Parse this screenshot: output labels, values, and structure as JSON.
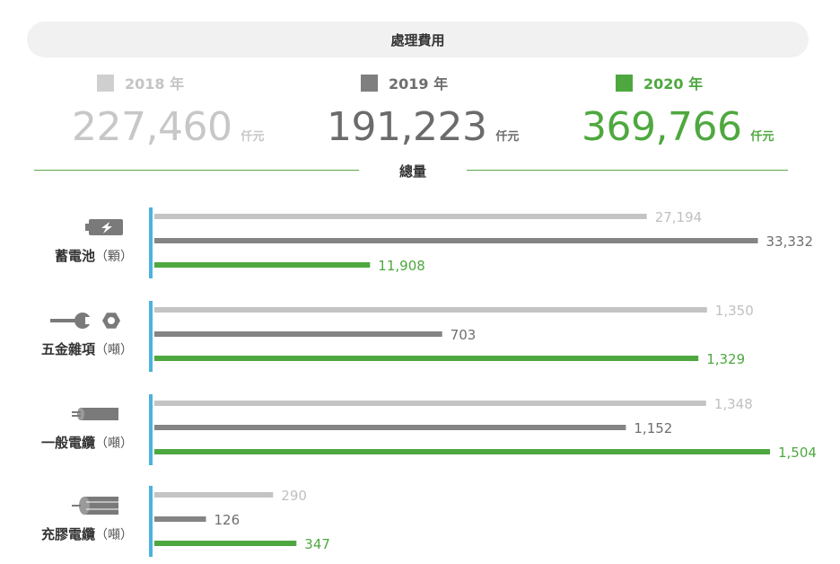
{
  "header": {
    "title": "處理費用"
  },
  "costs": [
    {
      "year": "2018 年",
      "value": "227,460",
      "unit": "仟元",
      "color": "#cfcfcf",
      "text_color": "#c4c4c4",
      "value_color": "#c7c7c7"
    },
    {
      "year": "2019 年",
      "value": "191,223",
      "unit": "仟元",
      "color": "#7f7f7f",
      "text_color": "#6e6e6e",
      "value_color": "#6b6b6b"
    },
    {
      "year": "2020 年",
      "value": "369,766",
      "unit": "仟元",
      "color": "#4ea83f",
      "text_color": "#4ea83f",
      "value_color": "#4ea83f"
    }
  ],
  "section": {
    "title": "總量"
  },
  "chart_data": {
    "type": "bar",
    "orientation": "horizontal",
    "categories": [
      {
        "name": "蓄電池",
        "unit": "（顆）",
        "icon": "battery-icon",
        "max": 34000
      },
      {
        "name": "五金雜項",
        "unit": "（噸）",
        "icon": "wrench-bolt-icon",
        "max": 1504
      },
      {
        "name": "一般電纜",
        "unit": "（噸）",
        "icon": "cable-icon",
        "max": 1504
      },
      {
        "name": "充膠電纜",
        "unit": "（噸）",
        "icon": "gel-cable-icon",
        "max": 1504
      }
    ],
    "series": [
      {
        "name": "2018 年",
        "color": "#c4c4c4",
        "label_color": "#c0c0c0",
        "values": [
          27194,
          1350,
          1348,
          290
        ],
        "labels": [
          "27,194",
          "1,350",
          "1,348",
          "290"
        ]
      },
      {
        "name": "2019 年",
        "color": "#848484",
        "label_color": "#6e6e6e",
        "values": [
          33332,
          703,
          1152,
          126
        ],
        "labels": [
          "33,332",
          "703",
          "1,152",
          "126"
        ]
      },
      {
        "name": "2020 年",
        "color": "#4ea83f",
        "label_color": "#4ea83f",
        "values": [
          11908,
          1329,
          1504,
          347
        ],
        "labels": [
          "11,908",
          "1,329",
          "1,504",
          "347"
        ]
      }
    ]
  }
}
